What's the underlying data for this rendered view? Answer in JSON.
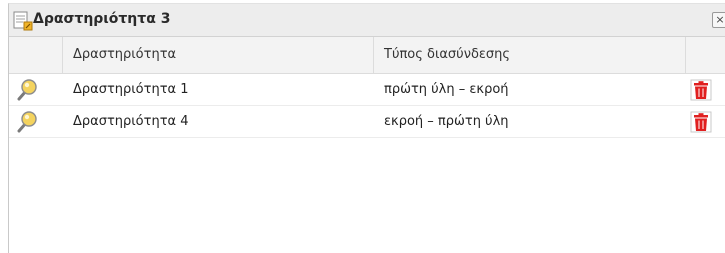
{
  "window": {
    "title": "Δραστηριότητα 3",
    "close_label": "×"
  },
  "table": {
    "columns": [
      "",
      "Δραστηριότητα",
      "Τύπος διασύνδεσης",
      ""
    ],
    "rows": [
      {
        "activity": "Δραστηριότητα 1",
        "link_type": "πρώτη ύλη – εκροή",
        "view_icon": "magnifier-icon",
        "delete_icon": "trash-icon"
      },
      {
        "activity": "Δραστηριότητα 4",
        "link_type": "εκροή – πρώτη ύλη",
        "view_icon": "magnifier-icon",
        "delete_icon": "trash-icon"
      }
    ]
  },
  "colors": {
    "title_bar": "#ededed",
    "header_bg": "#f3f3f3",
    "delete_red": "#e02020",
    "magnifier_yellow": "#f4d35e"
  }
}
